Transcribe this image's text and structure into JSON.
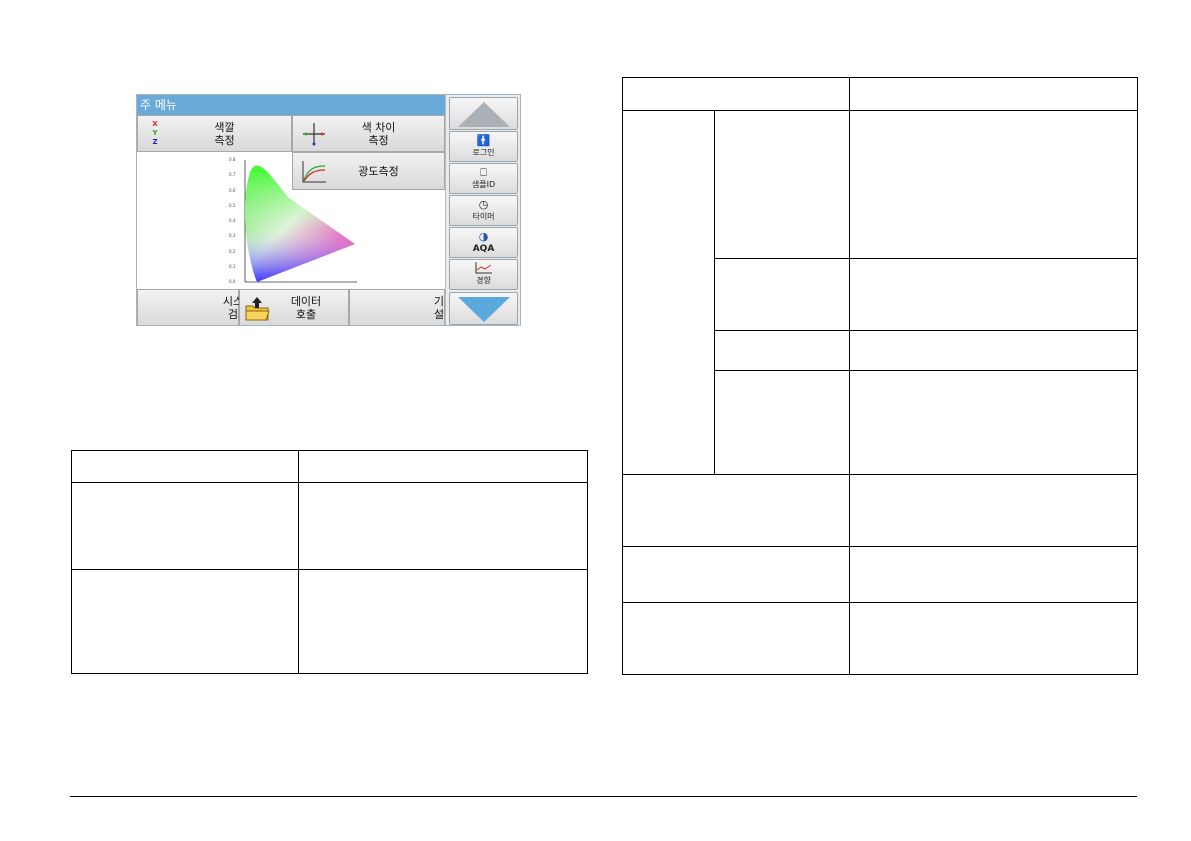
{
  "screen": {
    "title": "주 메뉴",
    "tiles": {
      "color_measure": {
        "line1": "색깔",
        "line2": "측정"
      },
      "color_diff": {
        "line1": "색 차이",
        "line2": "측정"
      },
      "photometry": {
        "label": "광도측정"
      },
      "system_check": {
        "line1": "시스템",
        "line2": "검사"
      },
      "data_recall": {
        "line1": "데이터",
        "line2": "호출"
      },
      "instrument_setup": {
        "line1": "기기",
        "line2": "설정"
      }
    },
    "xyz_icon": {
      "x": "X",
      "y": "Y",
      "z": "Z"
    },
    "sidebar": {
      "login": "로그인",
      "sample_id": "샘플ID",
      "timer": "타이머",
      "aqa": "AQA",
      "trend": "경향"
    },
    "chart_ticks": [
      "0.8",
      "0.7",
      "0.6",
      "0.5",
      "0.4",
      "0.3",
      "0.2",
      "0.1",
      "0.0"
    ]
  },
  "left_table": {
    "header": [
      "",
      ""
    ],
    "rows": [
      [
        "",
        ""
      ],
      [
        "",
        ""
      ]
    ]
  },
  "right_table": {
    "header": [
      "",
      ""
    ],
    "rows": [
      [
        "",
        "",
        ""
      ],
      [
        "",
        ""
      ],
      [
        "",
        ""
      ],
      [
        "",
        ""
      ],
      [
        "",
        ""
      ],
      [
        "",
        ""
      ],
      [
        "",
        ""
      ]
    ]
  },
  "colors": {
    "titlebar": "#6aaad9",
    "arrow": "#5aa9dc"
  }
}
